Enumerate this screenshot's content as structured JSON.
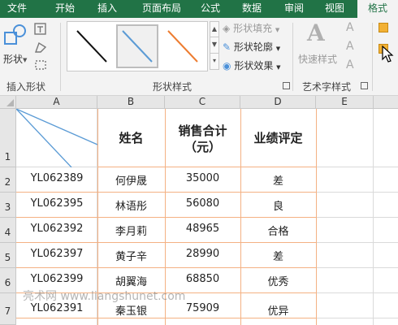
{
  "tabs": [
    "文件",
    "开始",
    "插入",
    "页面布局",
    "公式",
    "数据",
    "审阅",
    "视图",
    "格式"
  ],
  "ribbon": {
    "shapes_label": "形状",
    "insert_shapes_group": "插入形状",
    "shape_styles_group": "形状样式",
    "shape_fill": "形状填充",
    "shape_outline": "形状轮廓",
    "shape_effects": "形状效果",
    "quick_styles": "快速样式",
    "wordart_group": "艺术字样式"
  },
  "columns": [
    "A",
    "B",
    "C",
    "D",
    "E"
  ],
  "rows": [
    "1",
    "2",
    "3",
    "4",
    "5",
    "6",
    "7"
  ],
  "header": {
    "name": "姓名",
    "sales_line1": "销售合计",
    "sales_line2": "（元）",
    "rating": "业绩评定"
  },
  "data_rows": [
    {
      "id": "YL062389",
      "name": "何伊晟",
      "sales": "35000",
      "rating": "差"
    },
    {
      "id": "YL062395",
      "name": "林语彤",
      "sales": "56080",
      "rating": "良"
    },
    {
      "id": "YL062392",
      "name": "李月莉",
      "sales": "48965",
      "rating": "合格"
    },
    {
      "id": "YL062397",
      "name": "黄子辛",
      "sales": "28990",
      "rating": "差"
    },
    {
      "id": "YL062399",
      "name": "胡翼海",
      "sales": "68850",
      "rating": "优秀"
    },
    {
      "id": "YL062391",
      "name": "秦玉银",
      "sales": "75909",
      "rating": "优异"
    }
  ],
  "watermark": "亮术网 www.liangshunet.com",
  "colors": {
    "ribbon_green": "#217346",
    "diag_line": "#5b9bd5",
    "border_orange": "#f4b183"
  }
}
